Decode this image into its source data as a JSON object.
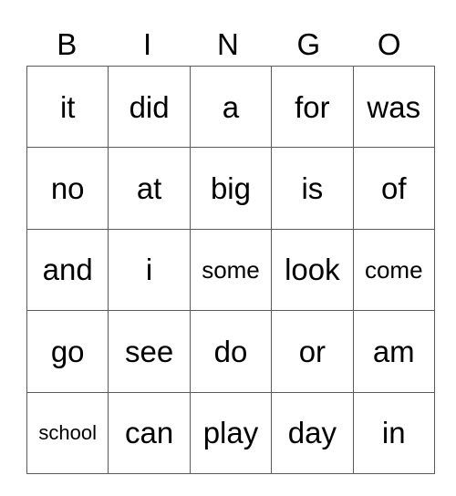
{
  "card": {
    "header": [
      "B",
      "I",
      "N",
      "G",
      "O"
    ],
    "rows": [
      [
        "it",
        "did",
        "a",
        "for",
        "was"
      ],
      [
        "no",
        "at",
        "big",
        "is",
        "of"
      ],
      [
        "and",
        "i",
        "some",
        "look",
        "come"
      ],
      [
        "go",
        "see",
        "do",
        "or",
        "am"
      ],
      [
        "school",
        "can",
        "play",
        "day",
        "in"
      ]
    ]
  }
}
